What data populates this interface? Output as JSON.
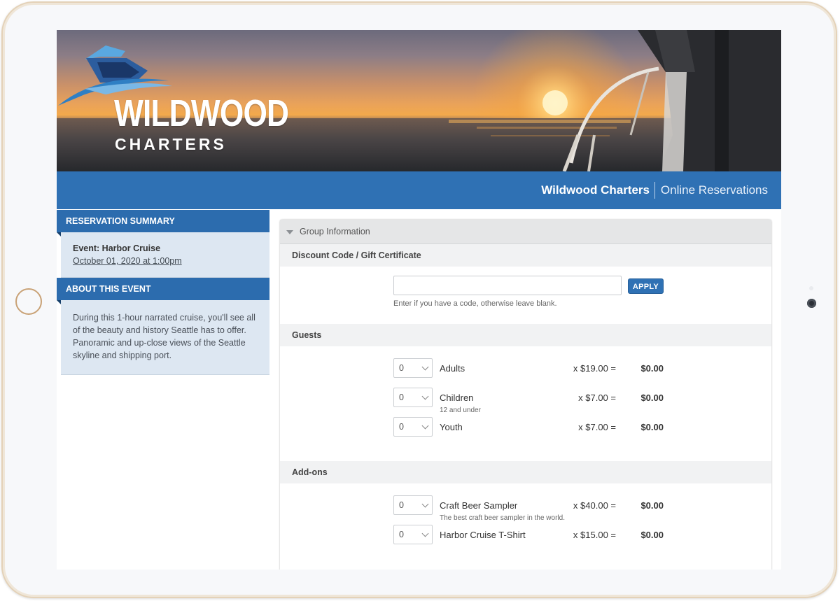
{
  "brand": {
    "logo_word": "WILDWOOD",
    "logo_sub": "CHARTERS",
    "name": "Wildwood Charters",
    "section": "Online Reservations"
  },
  "sidebar": {
    "summary_title": "RESERVATION SUMMARY",
    "event_label": "Event: Harbor Cruise",
    "event_date": "October 01, 2020 at 1:00pm",
    "about_title": "ABOUT THIS EVENT",
    "about_text": "During this 1-hour narrated cruise, you'll see all of the beauty and history Seattle has to offer. Panoramic and up-close views of the Seattle skyline and shipping port."
  },
  "form": {
    "group_title": "Group Information",
    "discount_title": "Discount Code / Gift Certificate",
    "code_value": "",
    "apply_label": "APPLY",
    "code_hint": "Enter if you have a code, otherwise leave blank.",
    "guests_title": "Guests",
    "guests": [
      {
        "qty": "0",
        "name": "Adults",
        "note": "",
        "price": "x $19.00 =",
        "total": "$0.00"
      },
      {
        "qty": "0",
        "name": "Children",
        "note": "12 and under",
        "price": "x $7.00 =",
        "total": "$0.00"
      },
      {
        "qty": "0",
        "name": "Youth",
        "note": "",
        "price": "x $7.00 =",
        "total": "$0.00"
      }
    ],
    "addons_title": "Add-ons",
    "addons": [
      {
        "qty": "0",
        "name": "Craft Beer Sampler",
        "note": "The best craft beer sampler in the world.",
        "price": "x $40.00 =",
        "total": "$0.00"
      },
      {
        "qty": "0",
        "name": "Harbor Cruise T-Shirt",
        "note": "",
        "price": "x $15.00 =",
        "total": "$0.00"
      }
    ]
  },
  "colors": {
    "brand_blue": "#2f71b4",
    "sidebar_head": "#2c6cae",
    "sidebar_body": "#dde7f2"
  },
  "icons": {
    "logo": "boat-logo-icon",
    "collapse": "triangle-down-icon",
    "select": "chevron-down-icon"
  }
}
